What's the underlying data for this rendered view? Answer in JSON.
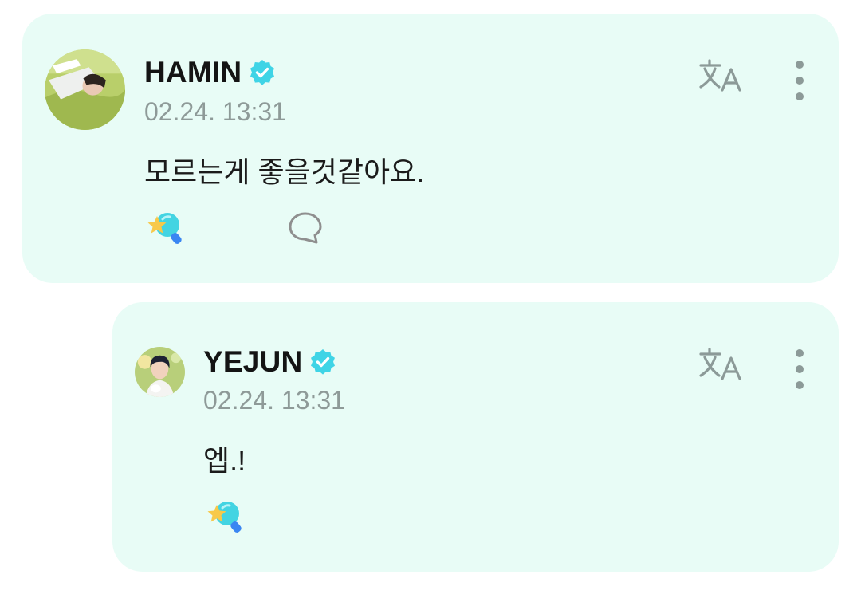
{
  "posts": [
    {
      "author": "HAMIN",
      "timestamp": "02.24. 13:31",
      "message": "모르는게 좋을것같아요."
    },
    {
      "author": "YEJUN",
      "timestamp": "02.24. 13:31",
      "message": "엡.!"
    }
  ],
  "icons": {
    "verified": "verified-badge-icon",
    "translate": "translate-icon",
    "more": "more-vertical-icon",
    "lightstick": "lightstick-icon",
    "comment": "comment-bubble-icon"
  },
  "colors": {
    "card_background": "#e8fcf6",
    "verified_badge": "#3fd4e6",
    "secondary_text": "#8e9a98"
  }
}
